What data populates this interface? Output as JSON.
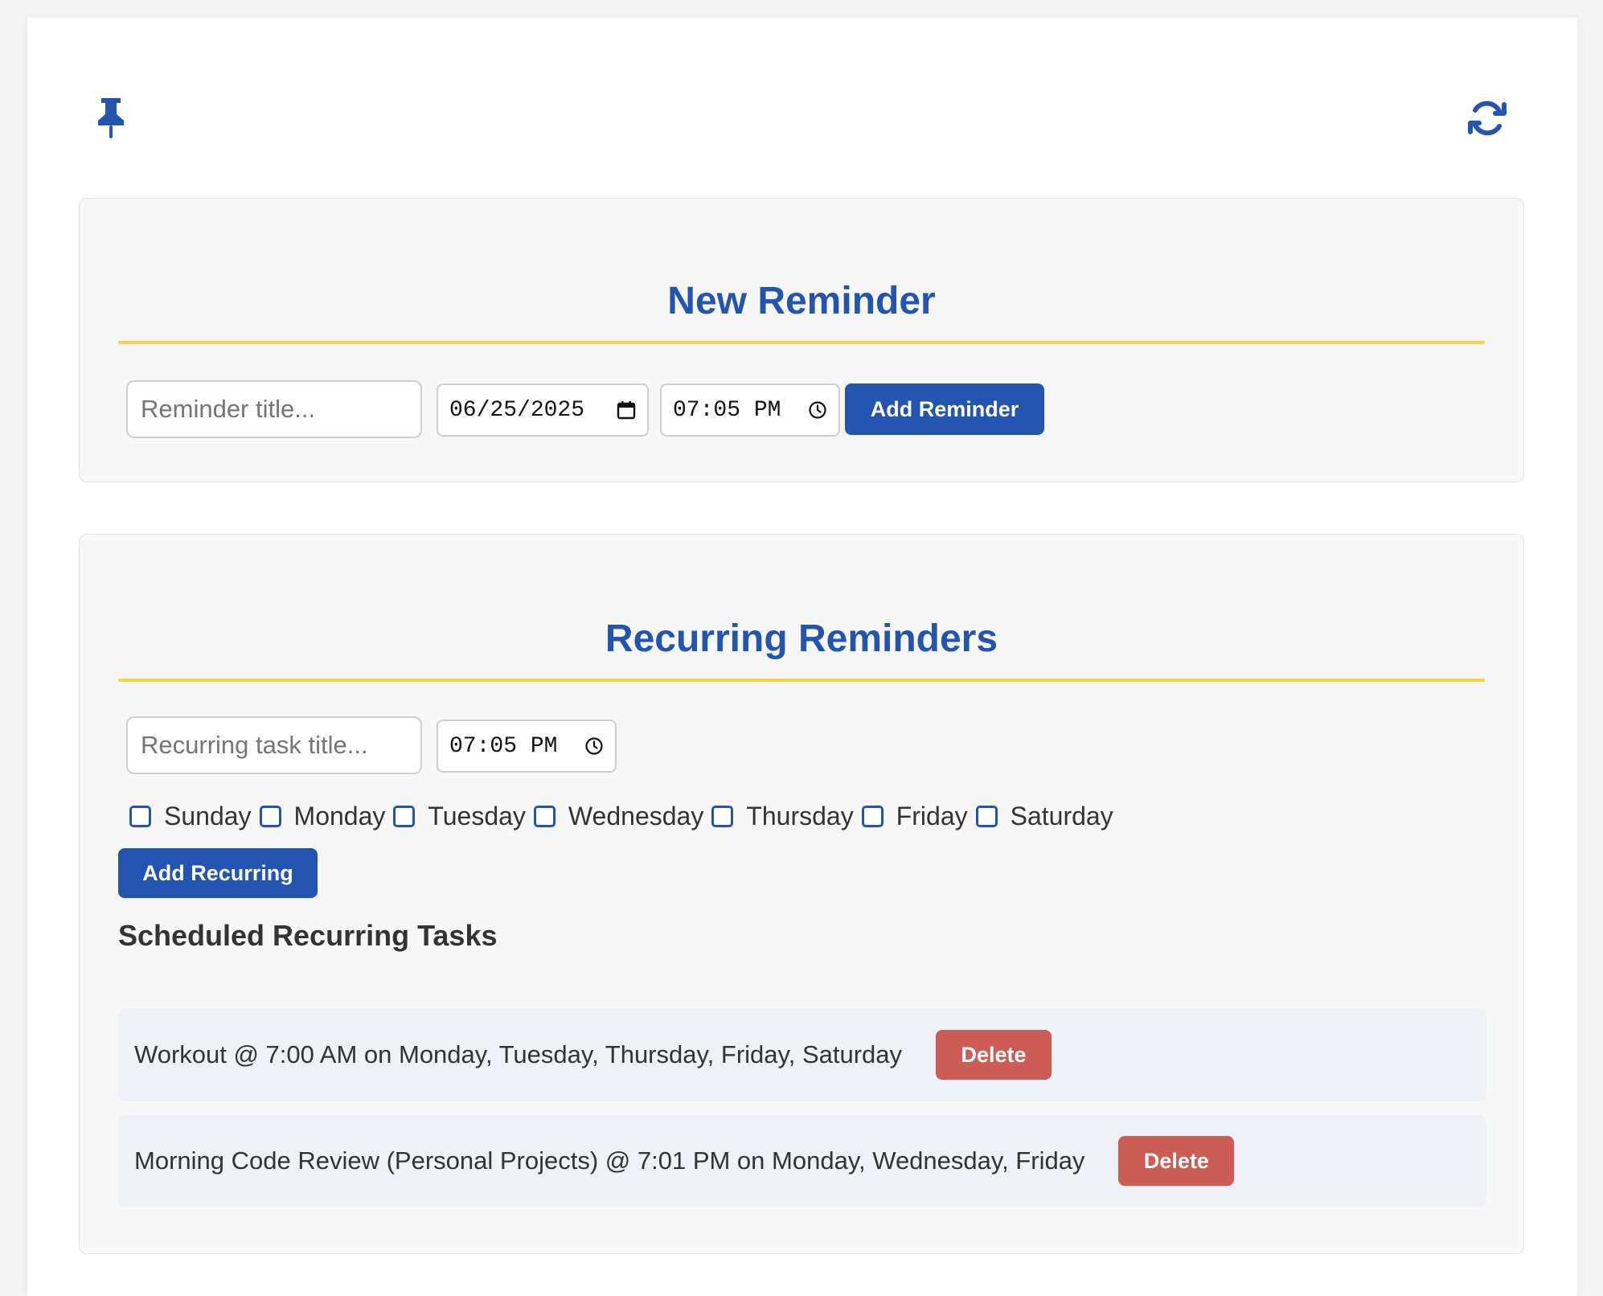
{
  "toolbar": {
    "pin_icon": "pin-icon",
    "refresh_icon": "refresh-icon"
  },
  "new_reminder": {
    "title": "New Reminder",
    "title_placeholder": "Reminder title...",
    "date_value": "06/25/2025",
    "time_value": "07:05 PM",
    "add_label": "Add Reminder"
  },
  "recurring": {
    "title": "Recurring Reminders",
    "title_placeholder": "Recurring task title...",
    "time_value": "07:05 PM",
    "days": [
      "Sunday",
      "Monday",
      "Tuesday",
      "Wednesday",
      "Thursday",
      "Friday",
      "Saturday"
    ],
    "add_label": "Add Recurring",
    "scheduled_heading": "Scheduled Recurring Tasks",
    "tasks": [
      {
        "text": "Workout @ 7:00 AM on Monday, Tuesday, Thursday, Friday, Saturday",
        "delete_label": "Delete"
      },
      {
        "text": "Morning Code Review (Personal Projects) @ 7:01 PM on Monday, Wednesday, Friday",
        "delete_label": "Delete"
      }
    ]
  },
  "colors": {
    "accent": "#2354b0",
    "underline": "#f5d547",
    "danger": "#cd5c54"
  }
}
